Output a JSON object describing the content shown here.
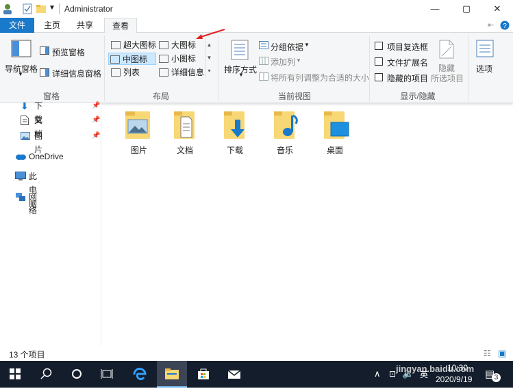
{
  "window": {
    "title": "Administrator",
    "controls": [
      "—",
      "▢",
      "✕"
    ]
  },
  "tabs": [
    {
      "label": "文件"
    },
    {
      "label": "主页"
    },
    {
      "label": "共享"
    },
    {
      "label": "查看"
    }
  ],
  "ribbon": {
    "panes": {
      "nav_pane": "导航窗格",
      "preview_pane": "预览窗格",
      "details_pane": "详细信息窗格",
      "group": "窗格"
    },
    "layout": {
      "items": [
        "超大图标",
        "大图标",
        "中图标",
        "小图标",
        "列表",
        "详细信息"
      ],
      "selected": "中图标",
      "group": "布局"
    },
    "current_view": {
      "sort_by": "排序方式",
      "group_by": "分组依据",
      "add_columns": "添加列",
      "size_all_columns": "将所有列调整为合适的大小",
      "group": "当前视图"
    },
    "show_hide": {
      "item_checkboxes": "项目复选框",
      "file_extensions": "文件扩展名",
      "hidden_items": "隐藏的项目",
      "hide_selected_line1": "隐藏",
      "hide_selected_line2": "所选项目",
      "group": "显示/隐藏"
    },
    "options": "选项"
  },
  "nav": {
    "items": [
      {
        "label": "下载",
        "pinned": true
      },
      {
        "label": "文档",
        "pinned": true
      },
      {
        "label": "图片",
        "pinned": true
      },
      {
        "label": "OneDrive"
      },
      {
        "label": "此电脑"
      },
      {
        "label": "网络"
      }
    ]
  },
  "folders": [
    {
      "label": "图片"
    },
    {
      "label": "文档"
    },
    {
      "label": "下载"
    },
    {
      "label": "音乐"
    },
    {
      "label": "桌面"
    }
  ],
  "status": {
    "count": "13 个项目"
  },
  "taskbar": {
    "time": "10:30",
    "date": "2020/9/19",
    "lang": "英",
    "notif_count": "3",
    "watermark": "jingyan.baidu.com"
  },
  "colors": {
    "accent": "#1979ca",
    "folder": "#f8d775",
    "taskbar": "#141d2b",
    "selection": "#cce8ff",
    "arrow": "#e02020"
  }
}
